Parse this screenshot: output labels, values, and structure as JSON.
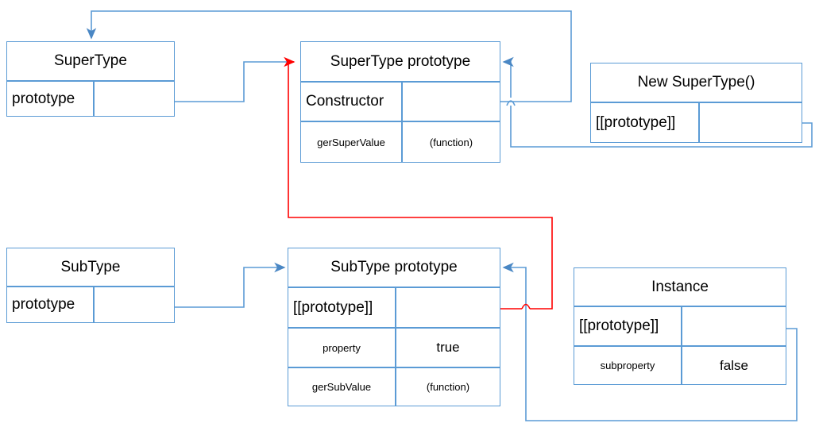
{
  "diagram": {
    "title": "JavaScript prototype chain diagram",
    "colors": {
      "box_border": "#5b9bd5",
      "wire_blue": "#5b9bd5",
      "wire_red": "#ff0000",
      "background": "#ffffff",
      "text": "#000000"
    }
  },
  "boxes": {
    "supertype": {
      "title": "SuperType",
      "rows": [
        {
          "key": "prototype",
          "value": ""
        }
      ]
    },
    "supertype_prototype": {
      "title": "SuperType  prototype",
      "rows": [
        {
          "key": "Constructor",
          "value": ""
        },
        {
          "key": "gerSuperValue",
          "value": "(function)"
        }
      ]
    },
    "new_supertype": {
      "title": "New SuperType()",
      "rows": [
        {
          "key": "[[prototype]]",
          "value": ""
        }
      ]
    },
    "subtype": {
      "title": "SubType",
      "rows": [
        {
          "key": "prototype",
          "value": ""
        }
      ]
    },
    "subtype_prototype": {
      "title": "SubType  prototype",
      "rows": [
        {
          "key": "[[prototype]]",
          "value": ""
        },
        {
          "key": "property",
          "value": "true"
        },
        {
          "key": "gerSubValue",
          "value": "(function)"
        }
      ]
    },
    "instance": {
      "title": "Instance",
      "rows": [
        {
          "key": "[[prototype]]",
          "value": ""
        },
        {
          "key": "subproperty",
          "value": "false"
        }
      ]
    }
  },
  "connectors": [
    {
      "name": "supertype-prototype-to-supertype-prototype-box",
      "color": "#5b9bd5",
      "arrow": "red-right"
    },
    {
      "name": "new-supertype-prototype-to-supertype-prototype-box",
      "color": "#5b9bd5",
      "arrow": "blue-left"
    },
    {
      "name": "supertype-prototype-constructor-to-supertype-box",
      "color": "#5b9bd5",
      "arrow": "blue-down"
    },
    {
      "name": "subtype-prototype-to-subtype-prototype-box",
      "color": "#5b9bd5",
      "arrow": "blue-right"
    },
    {
      "name": "instance-prototype-to-subtype-prototype-box",
      "color": "#5b9bd5",
      "arrow": "blue-left"
    },
    {
      "name": "subtype-prototype-proto-to-supertype-prototype-box",
      "color": "#ff0000",
      "arrow": "red-right"
    }
  ]
}
